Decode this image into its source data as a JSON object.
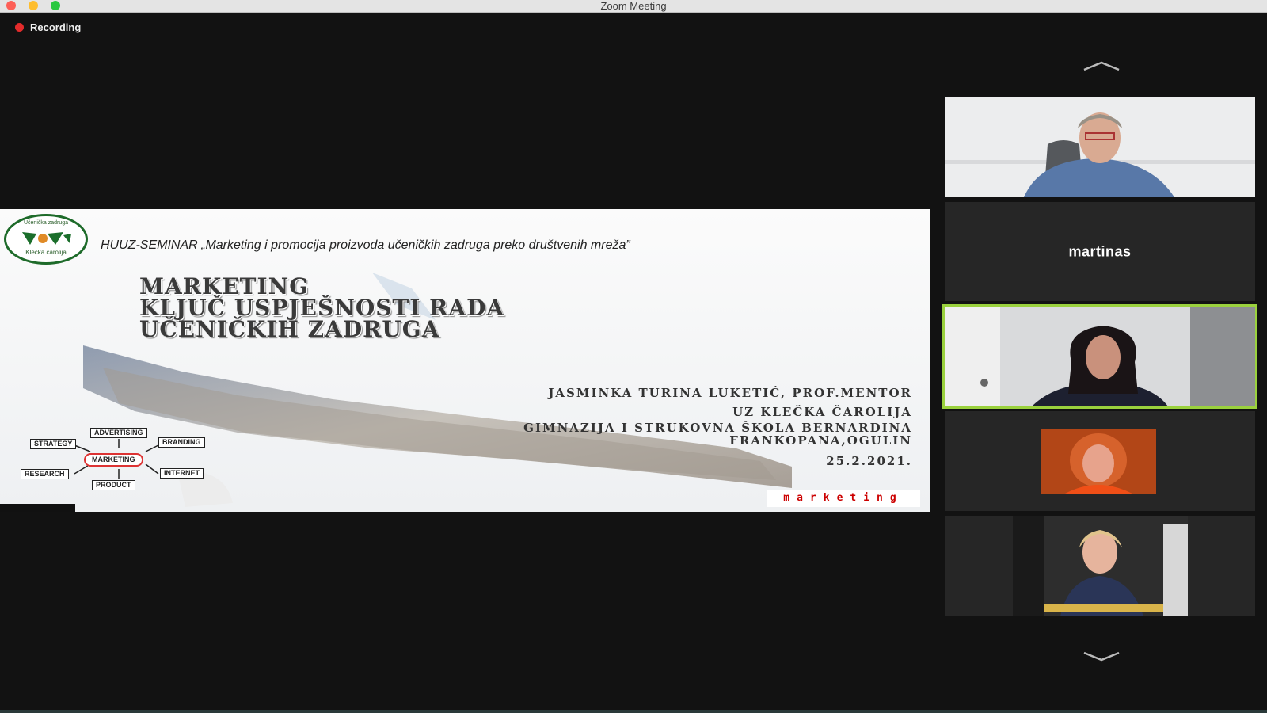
{
  "window": {
    "title": "Zoom Meeting"
  },
  "recording": {
    "label": "Recording",
    "indicator_color": "#e32b2b"
  },
  "slide": {
    "logo": {
      "top_text": "Učenička zadruga",
      "bottom_text": "Klečka čarolija"
    },
    "seminar_line": "HUUZ-SEMINAR „Marketing i promocija proizvoda učeničkih zadruga preko društvenih mreža”",
    "title_lines": [
      "MARKETING",
      "KLJUČ USPJEŠNOSTI RADA",
      "UČENIČKIH ZADRUGA"
    ],
    "author": "JASMINKA TURINA LUKETIĆ, PROF.MENTOR",
    "organization": "UZ KLEČKA ČAROLIJA",
    "school_line_1": "GIMNAZIJA I STRUKOVNA ŠKOLA BERNARDINA",
    "school_line_2": "FRANKOPANA,OGULIN",
    "date": "25.2.2021.",
    "diagram": {
      "center": "MARKETING",
      "nodes": {
        "advertising": "ADVERTISING",
        "strategy": "STRATEGY",
        "branding": "BRANDING",
        "research": "RESEARCH",
        "internet": "INTERNET",
        "product": "PRODUCT"
      }
    },
    "wordmark": "marketing"
  },
  "participants": [
    {
      "name": "",
      "video": true
    },
    {
      "name": "martinas",
      "video": false
    },
    {
      "name": "",
      "video": true,
      "active_speaker": true
    },
    {
      "name": "",
      "video": true
    },
    {
      "name": "",
      "video": true
    }
  ],
  "colors": {
    "active_speaker_border": "#9ad13d",
    "background": "#121212",
    "tile": "#262626"
  }
}
